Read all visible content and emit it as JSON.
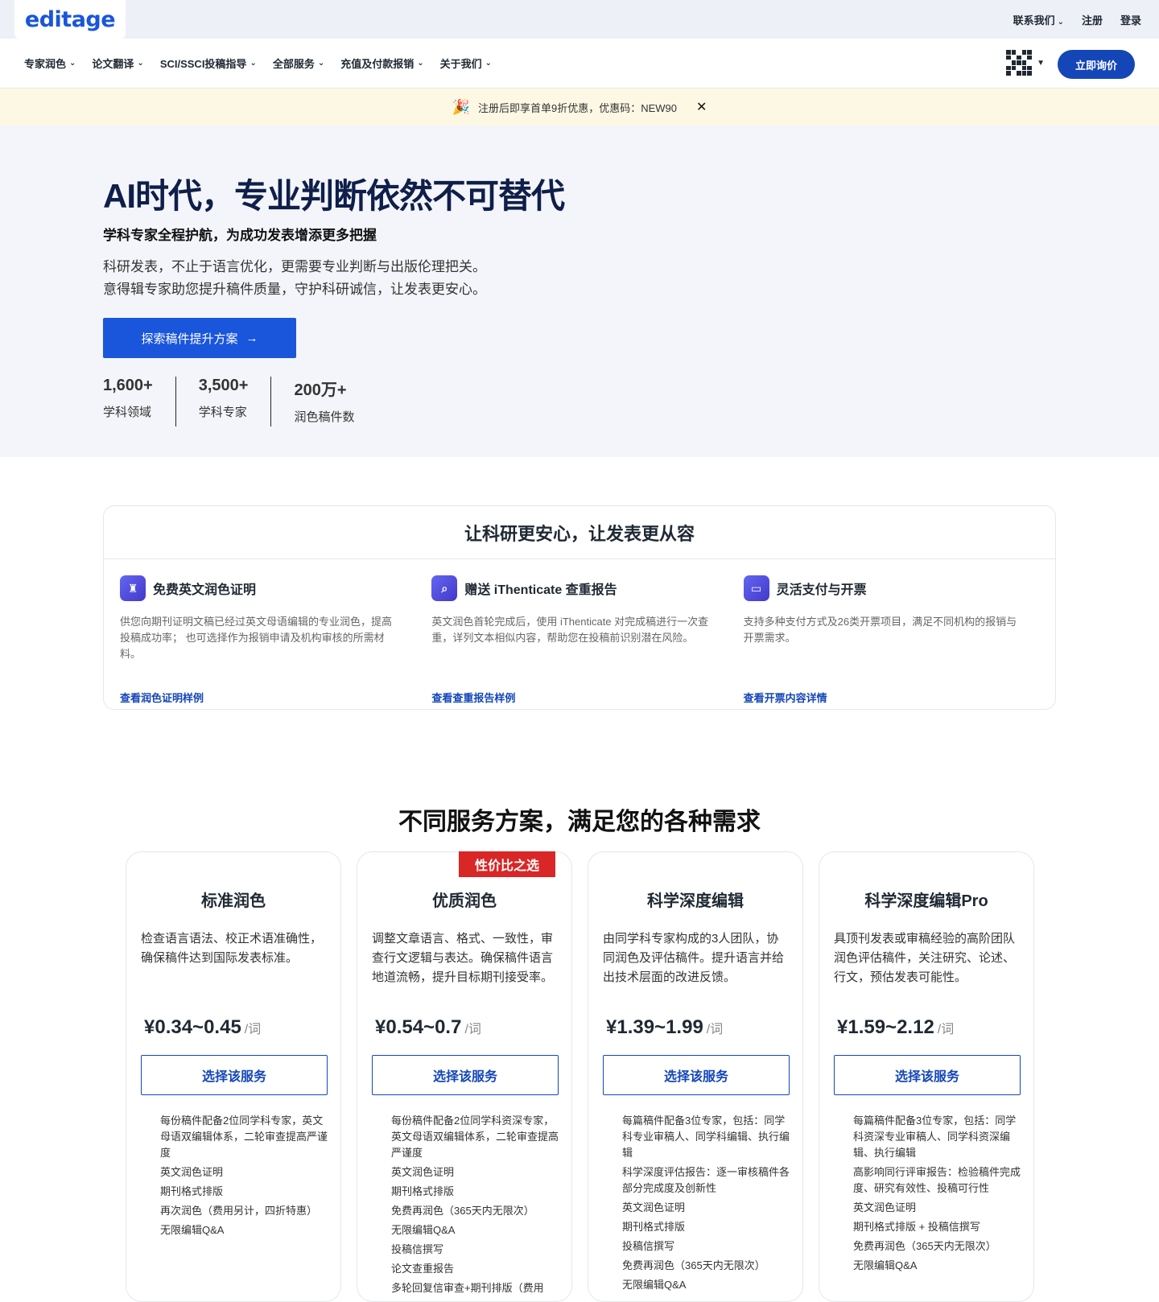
{
  "topbar": {
    "logo": "editage",
    "links": [
      {
        "label": "联系我们",
        "has_menu": true
      },
      {
        "label": "注册",
        "has_menu": false
      },
      {
        "label": "登录",
        "has_menu": false
      }
    ]
  },
  "nav": {
    "items": [
      {
        "label": "专家润色"
      },
      {
        "label": "论文翻译"
      },
      {
        "label": "SCI/SSCI投稿指导"
      },
      {
        "label": "全部服务"
      },
      {
        "label": "充值及付款报销"
      },
      {
        "label": "关于我们"
      }
    ],
    "quote_button": "立即询价",
    "qr_icon": "qr-code-icon"
  },
  "promo": {
    "text": "注册后即享首单9折优惠，优惠码：NEW90",
    "icon": "party-popper-icon",
    "close_icon": "close-icon"
  },
  "hero": {
    "title": "AI时代，专业判断依然不可替代",
    "subtitle": "学科专家全程护航，为成功发表增添更多把握",
    "desc_line1": "科研发表，不止于语言优化，更需要专业判断与出版伦理把关。",
    "desc_line2": "意得辑专家助您提升稿件质量，守护科研诚信，让发表更安心。",
    "cta": "探索稿件提升方案",
    "stats": [
      {
        "num": "1,600+",
        "label": "学科领域"
      },
      {
        "num": "3,500+",
        "label": "学科专家"
      },
      {
        "num": "200万+",
        "label": "润色稿件数"
      }
    ]
  },
  "trust": {
    "title": "让科研更安心，让发表更从容",
    "items": [
      {
        "icon": "certificate-icon",
        "title": "免费英文润色证明",
        "desc": "供您向期刊证明文稿已经过英文母语编辑的专业润色，提高投稿成功率； 也可选择作为报销申请及机构审核的所需材料。",
        "link": "查看润色证明样例"
      },
      {
        "icon": "search-icon",
        "title": "赠送 iThenticate 查重报告",
        "desc": "英文润色首轮完成后，使用 iThenticate 对完成稿进行一次查重，详列文本相似内容，帮助您在投稿前识别潜在风险。",
        "link": "查看查重报告样例"
      },
      {
        "icon": "payment-card-icon",
        "title": "灵活支付与开票",
        "desc": "支持多种支付方式及26类开票项目，满足不同机构的报销与开票需求。",
        "link": "查看开票内容详情"
      }
    ]
  },
  "plans": {
    "title": "不同服务方案，满足您的各种需求",
    "items": [
      {
        "name": "标准润色",
        "badge": "",
        "desc": "检查语言语法、校正术语准确性，确保稿件达到国际发表标准。",
        "price": "¥0.34~0.45",
        "unit": "/词",
        "button": "选择该服务",
        "features": [
          "每份稿件配备2位同学科专家，英文母语双编辑体系，二轮审查提高严谨度",
          "英文润色证明",
          "期刊格式排版",
          "再次润色（费用另计，四折特惠）",
          "无限编辑Q&A"
        ]
      },
      {
        "name": "优质润色",
        "badge": "性价比之选",
        "desc": "调整文章语言、格式、一致性，审查行文逻辑与表达。确保稿件语言地道流畅，提升目标期刊接受率。",
        "price": "¥0.54~0.7",
        "unit": "/词",
        "button": "选择该服务",
        "features": [
          "每份稿件配备2位同学科资深专家，英文母语双编辑体系，二轮审查提高严谨度",
          "英文润色证明",
          "期刊格式排版",
          "免费再润色（365天内无限次）",
          "无限编辑Q&A",
          "投稿信撰写",
          "论文查重报告",
          "多轮回复信审查+期刊排版（费用"
        ]
      },
      {
        "name": "科学深度编辑",
        "badge": "",
        "desc": "由同学科专家构成的3人团队，协同润色及评估稿件。提升语言并给出技术层面的改进反馈。",
        "price": "¥1.39~1.99",
        "unit": "/词",
        "button": "选择该服务",
        "features": [
          "每篇稿件配备3位专家，包括：同学科专业审稿人、同学科编辑、执行编辑",
          "科学深度评估报告：逐一审核稿件各部分完成度及创新性",
          "英文润色证明",
          "期刊格式排版",
          "投稿信撰写",
          "免费再润色（365天内无限次）",
          "无限编辑Q&A"
        ]
      },
      {
        "name": "科学深度编辑Pro",
        "badge": "",
        "desc": "具顶刊发表或审稿经验的高阶团队润色评估稿件，关注研究、论述、行文，预估发表可能性。",
        "price": "¥1.59~2.12",
        "unit": "/词",
        "button": "选择该服务",
        "features": [
          "每篇稿件配备3位专家，包括：同学科资深专业审稿人、同学科资深编辑、执行编辑",
          "高影响同行评审报告：检验稿件完成度、研究有效性、投稿可行性",
          "英文润色证明",
          "期刊格式排版 + 投稿信撰写",
          "免费再润色（365天内无限次）",
          "无限编辑Q&A"
        ]
      }
    ]
  }
}
